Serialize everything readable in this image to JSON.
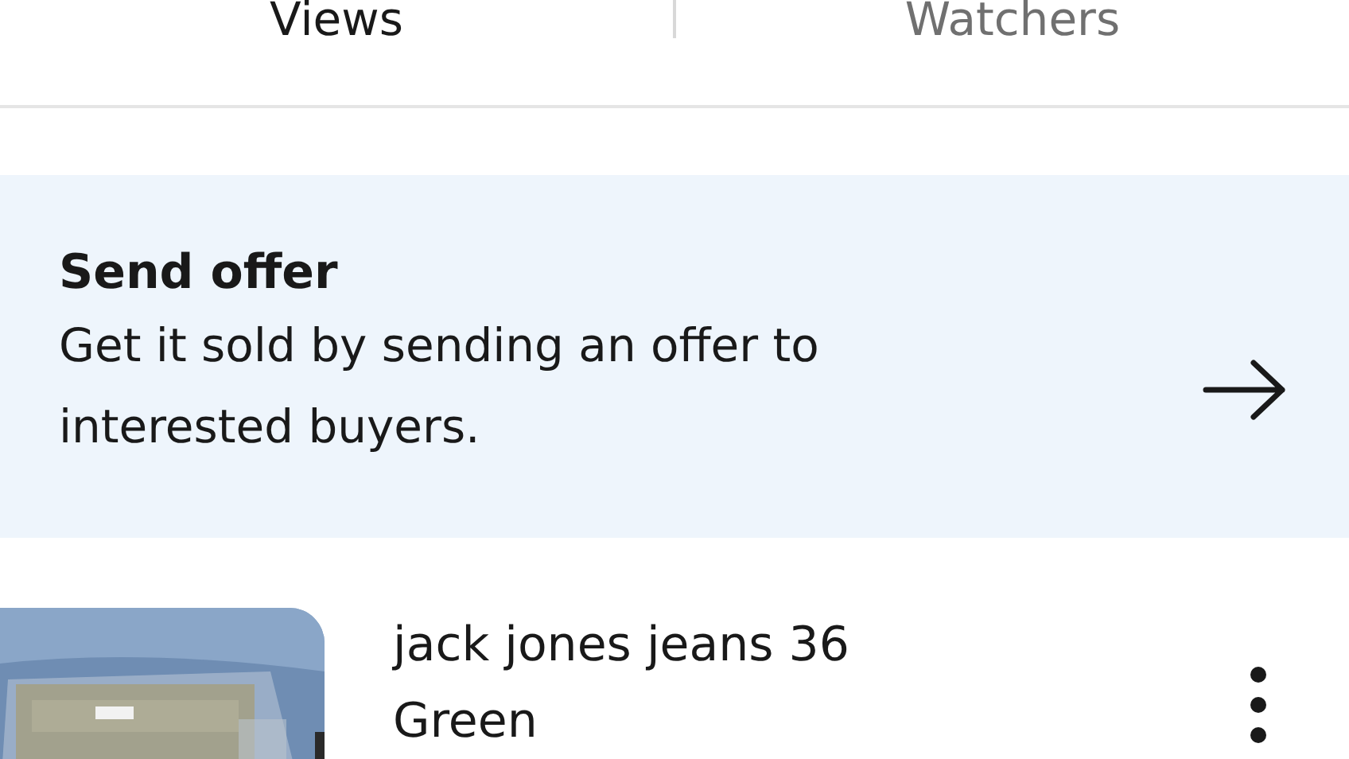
{
  "stats": [
    {
      "label": "Views"
    },
    {
      "label": "Watchers"
    }
  ],
  "offer_banner": {
    "title": "Send offer",
    "description": "Get it sold by sending an offer to interested buyers."
  },
  "listing": {
    "title": "jack jones jeans 36",
    "subtitle": "Green"
  }
}
